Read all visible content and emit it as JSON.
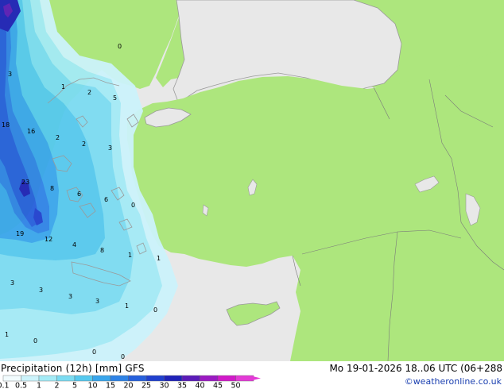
{
  "header": {
    "title": "Precipitation (12h) [mm] GFS",
    "datetime": "Mo 19-01-2026 18..06 UTC (06+288",
    "credit": "©weatheronline.co.uk"
  },
  "legend": {
    "values": [
      "0.1",
      "0.5",
      "1",
      "2",
      "5",
      "10",
      "15",
      "20",
      "25",
      "30",
      "35",
      "40",
      "45",
      "50"
    ],
    "colors": [
      "#f2fcfe",
      "#ccf3fb",
      "#a4ebf6",
      "#7cdcf2",
      "#56c9ee",
      "#3aa6ec",
      "#2f83e6",
      "#2660dc",
      "#2040ce",
      "#1f22b8",
      "#5b1bb8",
      "#9b1ac2",
      "#d11ac9",
      "#e33bd6"
    ]
  },
  "map_labels": [
    "0",
    "3",
    "1",
    "2",
    "5",
    "18",
    "16",
    "2",
    "2",
    "3",
    "23",
    "8",
    "6",
    "6",
    "0",
    "19",
    "12",
    "4",
    "8",
    "1",
    "1",
    "3",
    "3",
    "3",
    "3",
    "1",
    "0",
    "1",
    "0",
    "0",
    "0"
  ],
  "colors": {
    "land": "#ade67d",
    "out_of_domain": "#e8e8e8",
    "coast": "#9a9a9a",
    "border": "#7a7a7a"
  }
}
